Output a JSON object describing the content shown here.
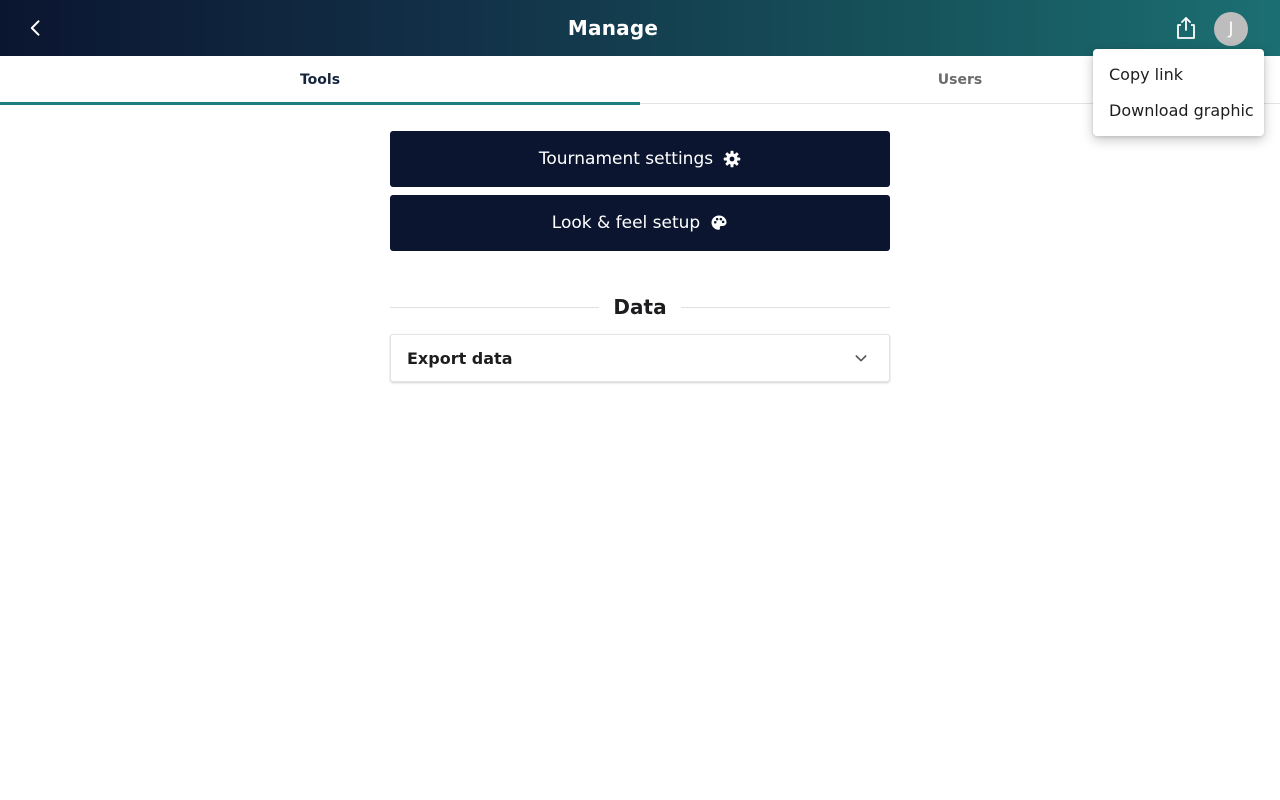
{
  "header": {
    "title": "Manage",
    "back_icon": "chevron-left-icon",
    "share_icon": "share-icon",
    "avatar_initial": "J"
  },
  "tabs": [
    {
      "label": "Tools",
      "active": true
    },
    {
      "label": "Users",
      "active": false
    }
  ],
  "main": {
    "buttons": [
      {
        "label": "Tournament settings",
        "icon": "gear-icon"
      },
      {
        "label": "Look & feel setup",
        "icon": "palette-icon"
      }
    ],
    "section_title": "Data",
    "accordion": {
      "label": "Export data",
      "icon": "chevron-down-icon",
      "expanded": false
    }
  },
  "share_menu": {
    "items": [
      {
        "label": "Copy link"
      },
      {
        "label": "Download graphic"
      }
    ]
  },
  "colors": {
    "header_start": "#0b1530",
    "header_end": "#1b6f72",
    "button_bg": "#0b1530",
    "tab_indicator": "#1f7e7d",
    "avatar_bg": "#bdbdbd"
  }
}
